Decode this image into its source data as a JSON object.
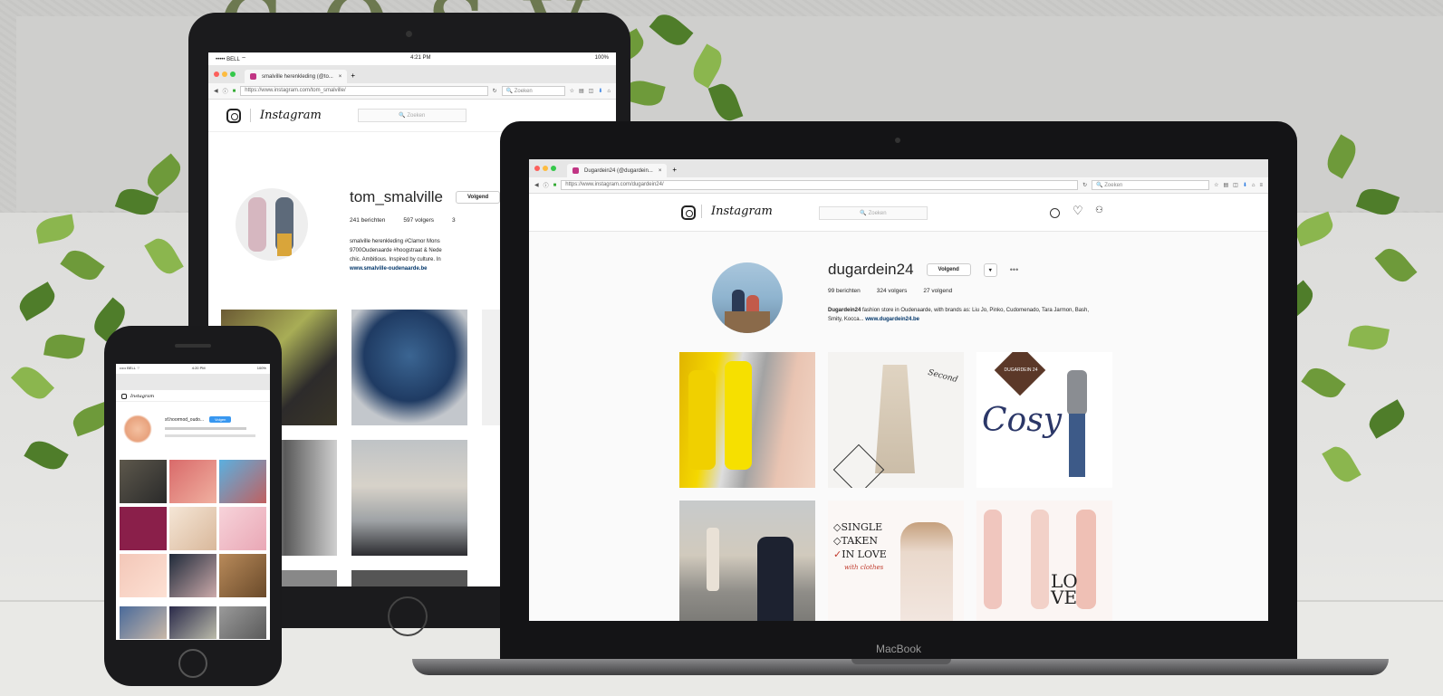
{
  "brand_deco": "cosy",
  "colors": {
    "accent_link": "#003569",
    "ig_text": "#262626",
    "plant": "#6e9a3a"
  },
  "ipad": {
    "status": {
      "carrier": "••••• BELL ⌔",
      "time": "4:21 PM",
      "battery": "100%"
    },
    "tab_title": "smalville herenkleding (@to...",
    "url": "https://www.instagram.com/tom_smalville/",
    "search_placeholder": "Zoeken",
    "ig_search_placeholder": "Zoeken",
    "username": "tom_smalville",
    "follow_label": "Volgend",
    "stats": {
      "posts": "241 berichten",
      "followers": "597 volgers",
      "following": "3"
    },
    "bio_lines": [
      "smalville herenkleding #Clamor Mons",
      "9700Oudenaarde #hoogstraat & Nede",
      "chic. Ambitious. Inspired by culture. In"
    ],
    "bio_link": "www.smalville-oudenaarde.be"
  },
  "iphone": {
    "status": {
      "carrier": "••••• BELL ⌔",
      "time": "4:20 PM",
      "battery": "100%"
    },
    "username": "sf.hoormod_oudo...",
    "follow_label": "Volgen",
    "ig_word": "Instagram"
  },
  "mac": {
    "brand": "MacBook",
    "tab_title": "Dugardein24 (@dugardein...",
    "url": "https://www.instagram.com/dugardein24/",
    "search_placeholder": "Zoeken",
    "ig_word": "Instagram",
    "ig_search_placeholder": "Zoeken",
    "username": "dugardein24",
    "follow_label": "Volgend",
    "stats": {
      "posts": "99 berichten",
      "followers": "324 volgers",
      "following": "27 volgend"
    },
    "bio_name": "Dugardein24",
    "bio_text": "fashion store in Oudenaarde, with brands as: Liu Jo, Pinko, Cudomenado, Tara Jarmon, Bash, Smity, Kocca... ",
    "bio_link": "www.dugardein24.be",
    "post_texts": {
      "cosy": "Cosy",
      "dugardein_badge": "DUGARDEIN 24",
      "second": "Second",
      "single_lines": [
        "SINGLE",
        "TAKEN",
        "IN LOVE"
      ],
      "with_clothes": "with clothes",
      "love": "LOVE"
    }
  }
}
